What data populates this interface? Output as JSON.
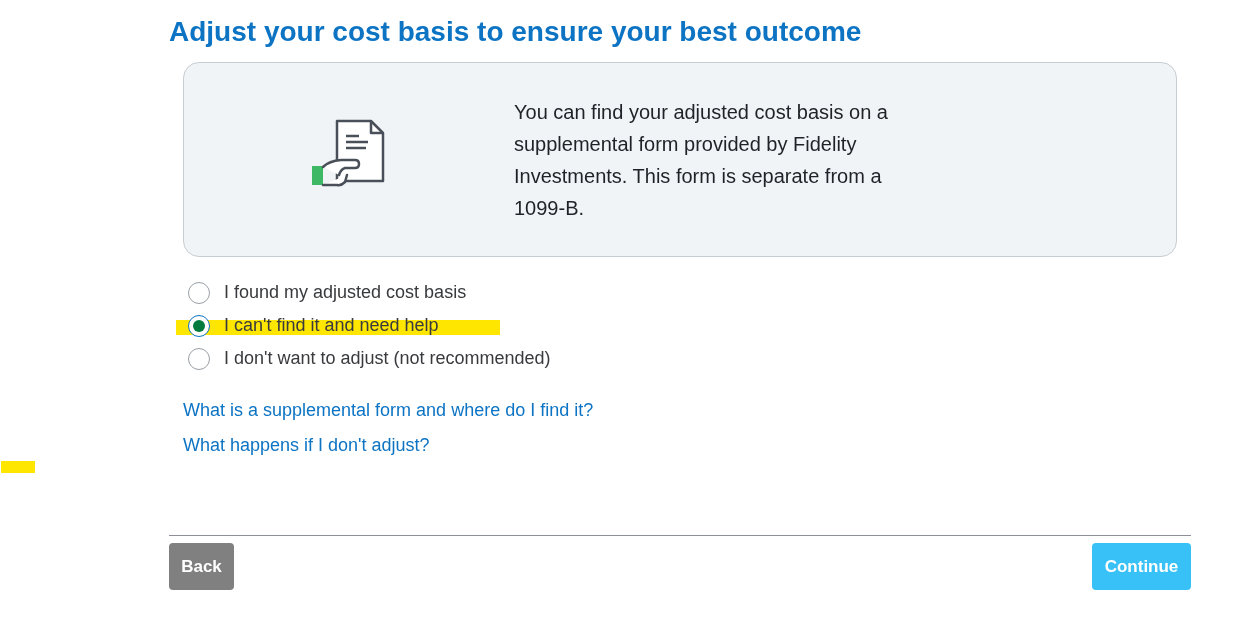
{
  "title": "Adjust your cost basis to ensure your best outcome",
  "info_card": {
    "text": "You can find your adjusted cost basis on a supplemental form provided by Fidelity Investments. This form is separate from a 1099-B."
  },
  "options": [
    {
      "label": "I found my adjusted cost basis",
      "selected": false,
      "highlighted": false
    },
    {
      "label": "I can't find it and need help",
      "selected": true,
      "highlighted": true
    },
    {
      "label": "I don't want to adjust (not recommended)",
      "selected": false,
      "highlighted": false
    }
  ],
  "links": [
    "What is a supplemental form and where do I find it?",
    "What happens if I don't adjust?"
  ],
  "buttons": {
    "back": "Back",
    "continue": "Continue"
  }
}
